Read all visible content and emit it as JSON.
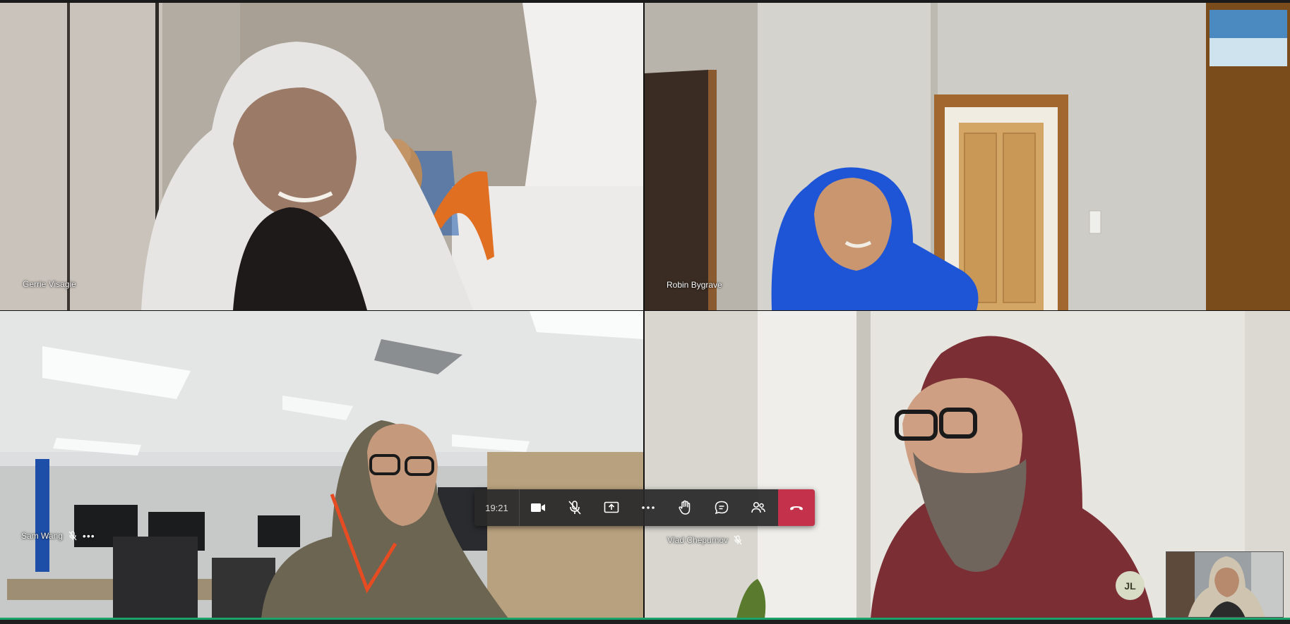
{
  "meeting": {
    "timer": "19:21",
    "controls": {
      "camera": "camera-icon",
      "mic": "mic-off-icon",
      "share": "share-screen-icon",
      "more": "more-icon",
      "raise_hand": "raise-hand-icon",
      "chat": "chat-icon",
      "participants": "participants-icon",
      "hangup": "hang-up-icon"
    },
    "hangup_color": "#c4314b",
    "accent_color": "#1aa36b"
  },
  "participants": [
    {
      "name": "Gerrie Visagie",
      "muted": false
    },
    {
      "name": "Robin Bygrave",
      "muted": false
    },
    {
      "name": "Sam Wang",
      "muted": true,
      "more": "•••"
    },
    {
      "name": "Vlad Chepurnov",
      "muted": true
    }
  ],
  "self": {
    "initials": "JL"
  }
}
